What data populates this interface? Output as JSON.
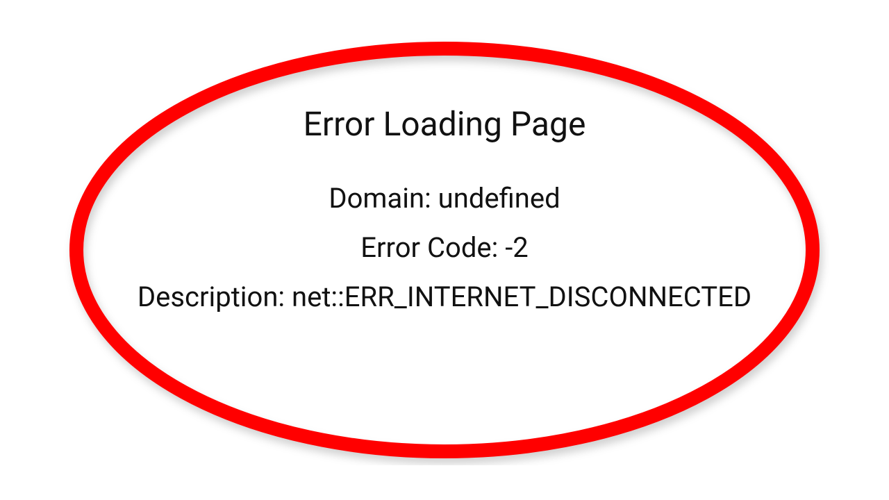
{
  "error": {
    "title": "Error Loading Page",
    "domain_line": "Domain: undefined",
    "code_line": "Error Code: -2",
    "description_line": "Description: net::ERR_INTERNET_DISCONNECTED"
  },
  "highlight": {
    "stroke_color": "#ff0000"
  }
}
